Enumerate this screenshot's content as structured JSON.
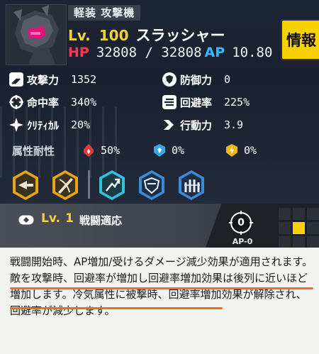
{
  "unit": {
    "class": "軽装 攻撃機",
    "level_label": "Lv.",
    "level": "100",
    "name": "スラッシャー",
    "hp_label": "HP",
    "hp": "32808 / 32808",
    "ap_label": "AP",
    "ap": "10.80",
    "info_button": "情報"
  },
  "stats": {
    "attack": {
      "label": "攻撃力",
      "value": "1352",
      "icon": "swords-icon"
    },
    "defense": {
      "label": "防御力",
      "value": "0",
      "icon": "shield-icon"
    },
    "accuracy": {
      "label": "命中率",
      "value": "340%",
      "icon": "crosshair-icon"
    },
    "evasion": {
      "label": "回避率",
      "value": "225%",
      "icon": "speed-lines-icon"
    },
    "critical": {
      "label": "ｸﾘﾃｨｶﾙ",
      "value": "20%",
      "icon": "sparkle-icon"
    },
    "mobility": {
      "label": "行動力",
      "value": "3.9",
      "icon": "chevron-right-icon"
    }
  },
  "resistances": {
    "label": "属性耐性",
    "fire": {
      "value": "50%",
      "icon": "fire-icon"
    },
    "ice": {
      "value": "0%",
      "icon": "ice-icon"
    },
    "electric": {
      "value": "0%",
      "icon": "lightning-icon"
    }
  },
  "skills": [
    {
      "name": "skill-blast",
      "color": "#e7a319"
    },
    {
      "name": "skill-slash",
      "color": "#e7a319"
    },
    {
      "name": "skill-dash",
      "color": "#2fc3e0"
    },
    {
      "name": "skill-shield-buff",
      "color": "#3d8ad6"
    },
    {
      "name": "skill-squad-buff",
      "color": "#3d8ad6"
    }
  ],
  "selected_skill": {
    "level_label": "Lv.",
    "level": "1",
    "title": "戦闘適応",
    "ap_cost_number": "0",
    "ap_cost_label": "AP-0"
  },
  "description": {
    "text": "戦闘開始時、AP増加/受けるダメージ減少効果が適用されます。敵を攻撃時、回避率が増加し回避率増加効果は後列に近いほど増加します。冷気属性に被撃時、回避率増加効果が解除され、回避率が減少します。"
  },
  "colors": {
    "accent_yellow": "#f7d100",
    "hp_red": "#ff3a4e",
    "ap_blue": "#39b8ff",
    "underline_orange": "#f26b1a"
  }
}
